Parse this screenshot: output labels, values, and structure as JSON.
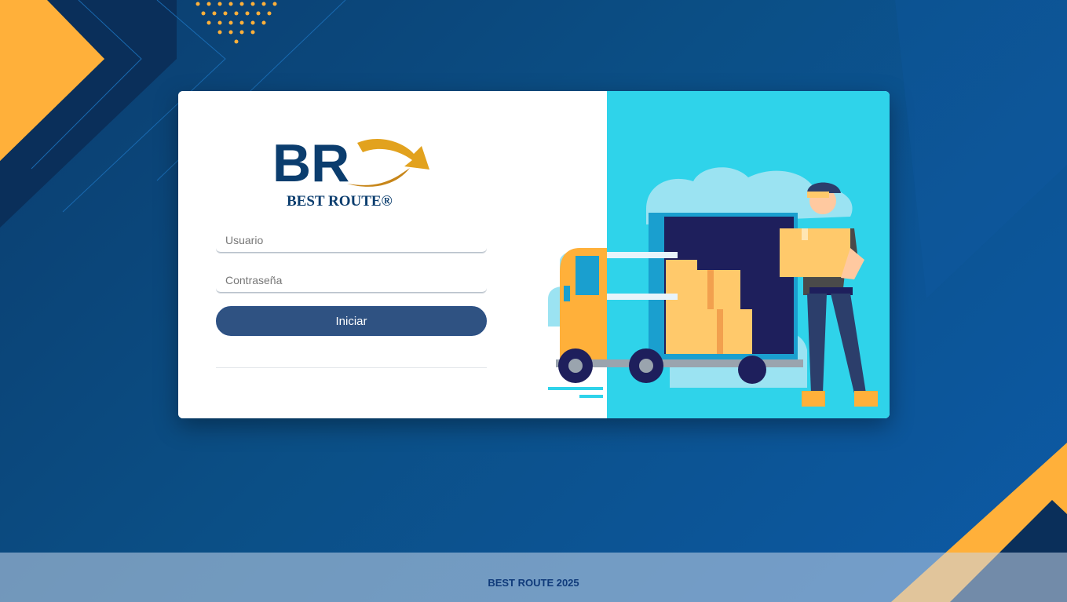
{
  "app": {
    "brand": "BEST ROUTE",
    "logo_letters": "BR",
    "logo_text": "BEST ROUTE®"
  },
  "login": {
    "username_placeholder": "Usuario",
    "password_placeholder": "Contraseña",
    "submit_label": "Iniciar"
  },
  "footer": {
    "text": "BEST ROUTE 2025"
  },
  "colors": {
    "background": "#0b4f86",
    "accent_orange": "#ffb03a",
    "button": "#2f5282",
    "illustration_bg": "#2fd3ea",
    "footer_text": "#0f3a7a"
  },
  "icons": [
    "best-route-logo",
    "delivery-truck-illustration",
    "delivery-man-illustration"
  ]
}
